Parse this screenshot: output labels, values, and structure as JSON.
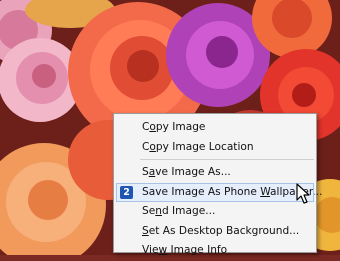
{
  "context_menu": {
    "items": [
      {
        "pre": "C",
        "key": "o",
        "post": "py Image"
      },
      {
        "pre": "C",
        "key": "o",
        "post": "py Image Location"
      },
      {
        "pre": "S",
        "key": "a",
        "post": "ve Image As..."
      },
      {
        "pre": "Save Image As Phone ",
        "key": "W",
        "post": "allpaper..."
      },
      {
        "pre": "Se",
        "key": "n",
        "post": "d Image..."
      },
      {
        "pre": "",
        "key": "S",
        "post": "et As Desktop Background..."
      },
      {
        "pre": "Vie",
        "key": "w",
        "post": " Image Info"
      }
    ],
    "highlighted_badge": "2"
  },
  "icons": {
    "badge": "numbered-square-icon",
    "pointer": "arrow-cursor-icon"
  }
}
